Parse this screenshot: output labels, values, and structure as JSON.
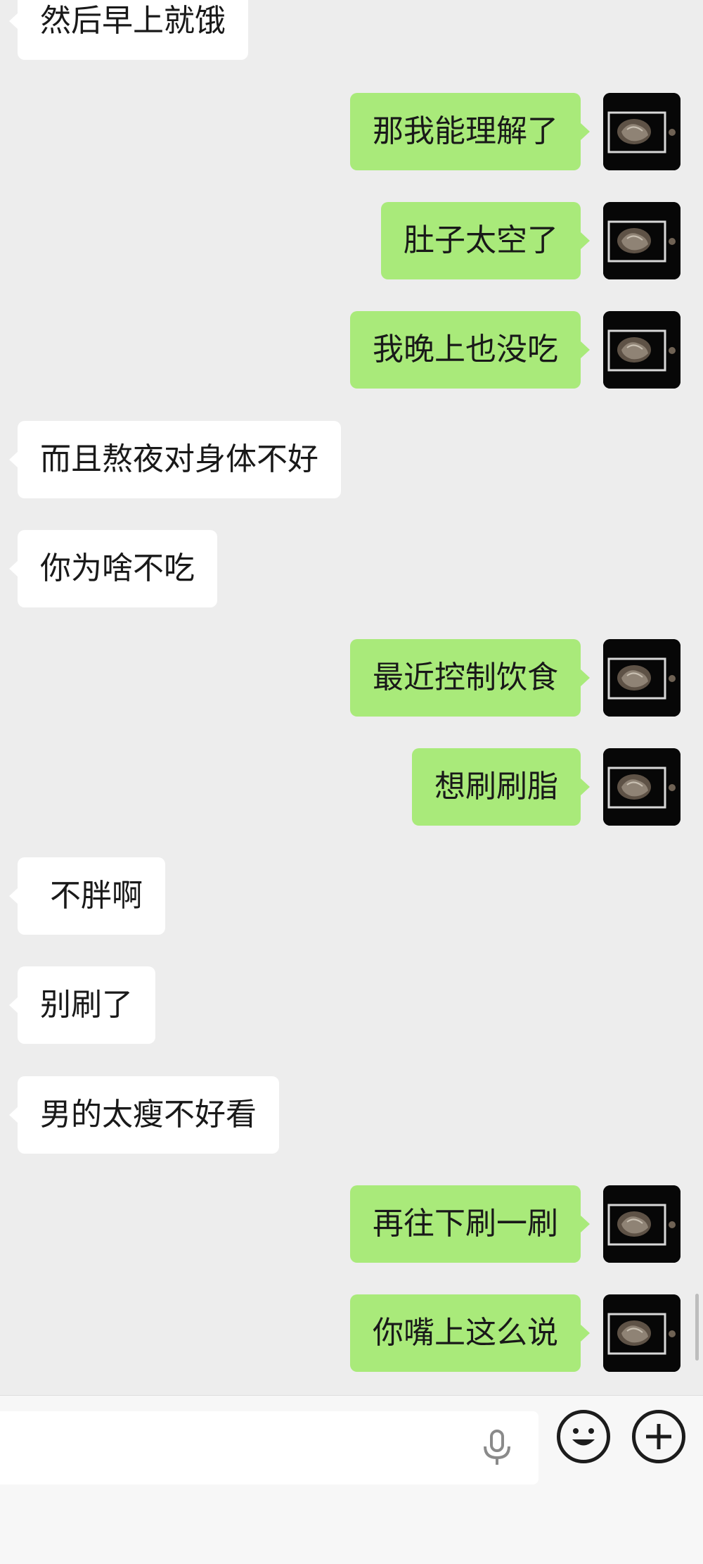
{
  "chat": {
    "messages": [
      {
        "side": "in",
        "text": "然后早上就饿"
      },
      {
        "side": "out",
        "text": "那我能理解了"
      },
      {
        "side": "out",
        "text": "肚子太空了"
      },
      {
        "side": "out",
        "text": "我晚上也没吃"
      },
      {
        "side": "in",
        "text": "而且熬夜对身体不好"
      },
      {
        "side": "in",
        "text": "你为啥不吃"
      },
      {
        "side": "out",
        "text": "最近控制饮食"
      },
      {
        "side": "out",
        "text": "想刷刷脂"
      },
      {
        "side": "in",
        "text": " 不胖啊"
      },
      {
        "side": "in",
        "text": "别刷了"
      },
      {
        "side": "in",
        "text": "男的太瘦不好看"
      },
      {
        "side": "out",
        "text": "再往下刷一刷"
      },
      {
        "side": "out",
        "text": "你嘴上这么说"
      }
    ]
  },
  "input_bar": {
    "text_value": "",
    "icons": {
      "mic": "microphone-icon",
      "emoji": "smiley-face-icon",
      "more": "plus-circle-icon"
    }
  },
  "colors": {
    "background": "#ededed",
    "outgoing_bubble": "#a9ea7a",
    "incoming_bubble": "#ffffff",
    "text": "#191919"
  }
}
